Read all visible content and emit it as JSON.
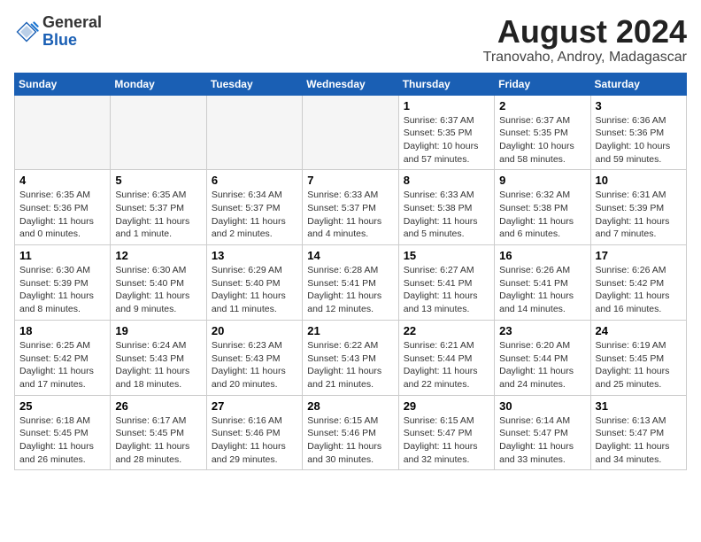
{
  "logo": {
    "general": "General",
    "blue": "Blue"
  },
  "header": {
    "month": "August 2024",
    "location": "Tranovaho, Androy, Madagascar"
  },
  "weekdays": [
    "Sunday",
    "Monday",
    "Tuesday",
    "Wednesday",
    "Thursday",
    "Friday",
    "Saturday"
  ],
  "weeks": [
    [
      {
        "day": "",
        "info": ""
      },
      {
        "day": "",
        "info": ""
      },
      {
        "day": "",
        "info": ""
      },
      {
        "day": "",
        "info": ""
      },
      {
        "day": "1",
        "info": "Sunrise: 6:37 AM\nSunset: 5:35 PM\nDaylight: 10 hours\nand 57 minutes."
      },
      {
        "day": "2",
        "info": "Sunrise: 6:37 AM\nSunset: 5:35 PM\nDaylight: 10 hours\nand 58 minutes."
      },
      {
        "day": "3",
        "info": "Sunrise: 6:36 AM\nSunset: 5:36 PM\nDaylight: 10 hours\nand 59 minutes."
      }
    ],
    [
      {
        "day": "4",
        "info": "Sunrise: 6:35 AM\nSunset: 5:36 PM\nDaylight: 11 hours\nand 0 minutes."
      },
      {
        "day": "5",
        "info": "Sunrise: 6:35 AM\nSunset: 5:37 PM\nDaylight: 11 hours\nand 1 minute."
      },
      {
        "day": "6",
        "info": "Sunrise: 6:34 AM\nSunset: 5:37 PM\nDaylight: 11 hours\nand 2 minutes."
      },
      {
        "day": "7",
        "info": "Sunrise: 6:33 AM\nSunset: 5:37 PM\nDaylight: 11 hours\nand 4 minutes."
      },
      {
        "day": "8",
        "info": "Sunrise: 6:33 AM\nSunset: 5:38 PM\nDaylight: 11 hours\nand 5 minutes."
      },
      {
        "day": "9",
        "info": "Sunrise: 6:32 AM\nSunset: 5:38 PM\nDaylight: 11 hours\nand 6 minutes."
      },
      {
        "day": "10",
        "info": "Sunrise: 6:31 AM\nSunset: 5:39 PM\nDaylight: 11 hours\nand 7 minutes."
      }
    ],
    [
      {
        "day": "11",
        "info": "Sunrise: 6:30 AM\nSunset: 5:39 PM\nDaylight: 11 hours\nand 8 minutes."
      },
      {
        "day": "12",
        "info": "Sunrise: 6:30 AM\nSunset: 5:40 PM\nDaylight: 11 hours\nand 9 minutes."
      },
      {
        "day": "13",
        "info": "Sunrise: 6:29 AM\nSunset: 5:40 PM\nDaylight: 11 hours\nand 11 minutes."
      },
      {
        "day": "14",
        "info": "Sunrise: 6:28 AM\nSunset: 5:41 PM\nDaylight: 11 hours\nand 12 minutes."
      },
      {
        "day": "15",
        "info": "Sunrise: 6:27 AM\nSunset: 5:41 PM\nDaylight: 11 hours\nand 13 minutes."
      },
      {
        "day": "16",
        "info": "Sunrise: 6:26 AM\nSunset: 5:41 PM\nDaylight: 11 hours\nand 14 minutes."
      },
      {
        "day": "17",
        "info": "Sunrise: 6:26 AM\nSunset: 5:42 PM\nDaylight: 11 hours\nand 16 minutes."
      }
    ],
    [
      {
        "day": "18",
        "info": "Sunrise: 6:25 AM\nSunset: 5:42 PM\nDaylight: 11 hours\nand 17 minutes."
      },
      {
        "day": "19",
        "info": "Sunrise: 6:24 AM\nSunset: 5:43 PM\nDaylight: 11 hours\nand 18 minutes."
      },
      {
        "day": "20",
        "info": "Sunrise: 6:23 AM\nSunset: 5:43 PM\nDaylight: 11 hours\nand 20 minutes."
      },
      {
        "day": "21",
        "info": "Sunrise: 6:22 AM\nSunset: 5:43 PM\nDaylight: 11 hours\nand 21 minutes."
      },
      {
        "day": "22",
        "info": "Sunrise: 6:21 AM\nSunset: 5:44 PM\nDaylight: 11 hours\nand 22 minutes."
      },
      {
        "day": "23",
        "info": "Sunrise: 6:20 AM\nSunset: 5:44 PM\nDaylight: 11 hours\nand 24 minutes."
      },
      {
        "day": "24",
        "info": "Sunrise: 6:19 AM\nSunset: 5:45 PM\nDaylight: 11 hours\nand 25 minutes."
      }
    ],
    [
      {
        "day": "25",
        "info": "Sunrise: 6:18 AM\nSunset: 5:45 PM\nDaylight: 11 hours\nand 26 minutes."
      },
      {
        "day": "26",
        "info": "Sunrise: 6:17 AM\nSunset: 5:45 PM\nDaylight: 11 hours\nand 28 minutes."
      },
      {
        "day": "27",
        "info": "Sunrise: 6:16 AM\nSunset: 5:46 PM\nDaylight: 11 hours\nand 29 minutes."
      },
      {
        "day": "28",
        "info": "Sunrise: 6:15 AM\nSunset: 5:46 PM\nDaylight: 11 hours\nand 30 minutes."
      },
      {
        "day": "29",
        "info": "Sunrise: 6:15 AM\nSunset: 5:47 PM\nDaylight: 11 hours\nand 32 minutes."
      },
      {
        "day": "30",
        "info": "Sunrise: 6:14 AM\nSunset: 5:47 PM\nDaylight: 11 hours\nand 33 minutes."
      },
      {
        "day": "31",
        "info": "Sunrise: 6:13 AM\nSunset: 5:47 PM\nDaylight: 11 hours\nand 34 minutes."
      }
    ]
  ]
}
